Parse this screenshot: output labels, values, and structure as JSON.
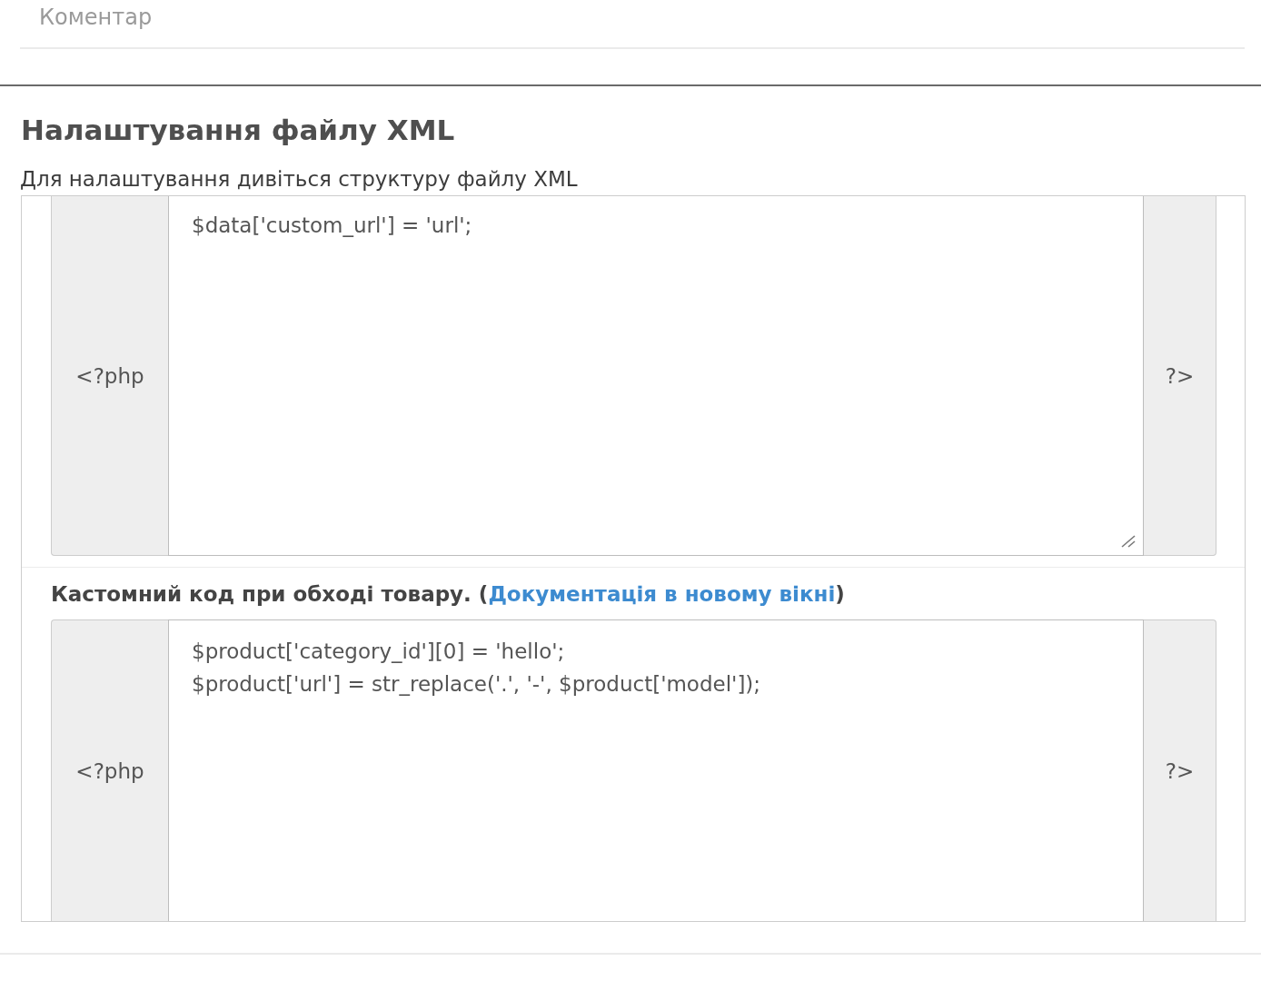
{
  "comment_field": {
    "placeholder": "Коментар"
  },
  "xml_settings": {
    "title": "Налаштування файлу XML",
    "description": "Для налаштування дивіться структуру файлу XML",
    "editors": [
      {
        "prefix": "<?php",
        "code": [
          "$data['custom_url'] = 'url';"
        ],
        "suffix": "?>",
        "resize_grip": true
      },
      {
        "label": {
          "text": "Кастомний код при обході товару. (",
          "link": "Документація в новому вікні",
          "after": ")"
        },
        "prefix": "<?php",
        "code": [
          "$product['category_id'][0] = 'hello';",
          "$product['url'] = str_replace('.', '-', $product['model']);"
        ],
        "suffix": "?>"
      }
    ]
  }
}
